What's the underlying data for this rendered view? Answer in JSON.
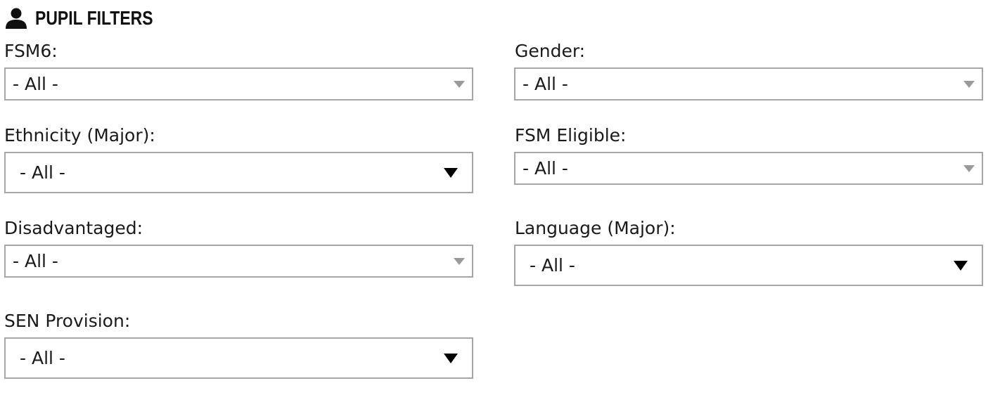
{
  "section": {
    "title": "PUPIL FILTERS",
    "icon": "user-icon"
  },
  "filters": {
    "fsm6": {
      "label": "FSM6:",
      "value": "- All -"
    },
    "gender": {
      "label": "Gender:",
      "value": "- All -"
    },
    "ethnicity_major": {
      "label": "Ethnicity (Major):",
      "value": "- All -"
    },
    "fsm_eligible": {
      "label": "FSM Eligible:",
      "value": "- All -"
    },
    "disadvantaged": {
      "label": "Disadvantaged:",
      "value": "- All -"
    },
    "language_major": {
      "label": "Language (Major):",
      "value": "- All -"
    },
    "sen_provision": {
      "label": "SEN Provision:",
      "value": "- All -"
    }
  },
  "colors": {
    "border": "#a6a6a6",
    "arrow_light": "#9a9a9a",
    "arrow_dark": "#000000",
    "text": "#1a1a1a"
  }
}
